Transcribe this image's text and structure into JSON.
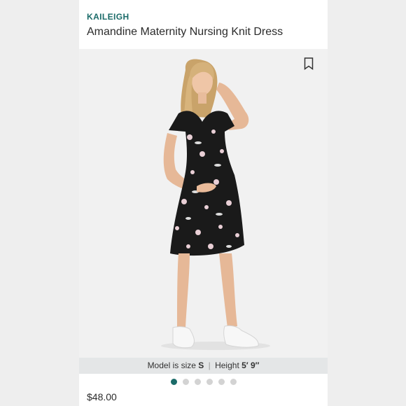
{
  "product": {
    "brand": "KAILEIGH",
    "title": "Amandine Maternity Nursing Knit Dress",
    "price": "$48.00"
  },
  "image": {
    "alt": "model wearing black floral knit dress",
    "bookmark_icon": "bookmark-icon"
  },
  "model_info": {
    "size_label": "Model is size",
    "size_value": "S",
    "separator": "|",
    "height_label": "Height",
    "height_value": "5′ 9″"
  },
  "carousel": {
    "count": 6,
    "active_index": 0
  },
  "colors": {
    "brand_teal": "#1b6b69",
    "dress": "#1a1a1a"
  }
}
